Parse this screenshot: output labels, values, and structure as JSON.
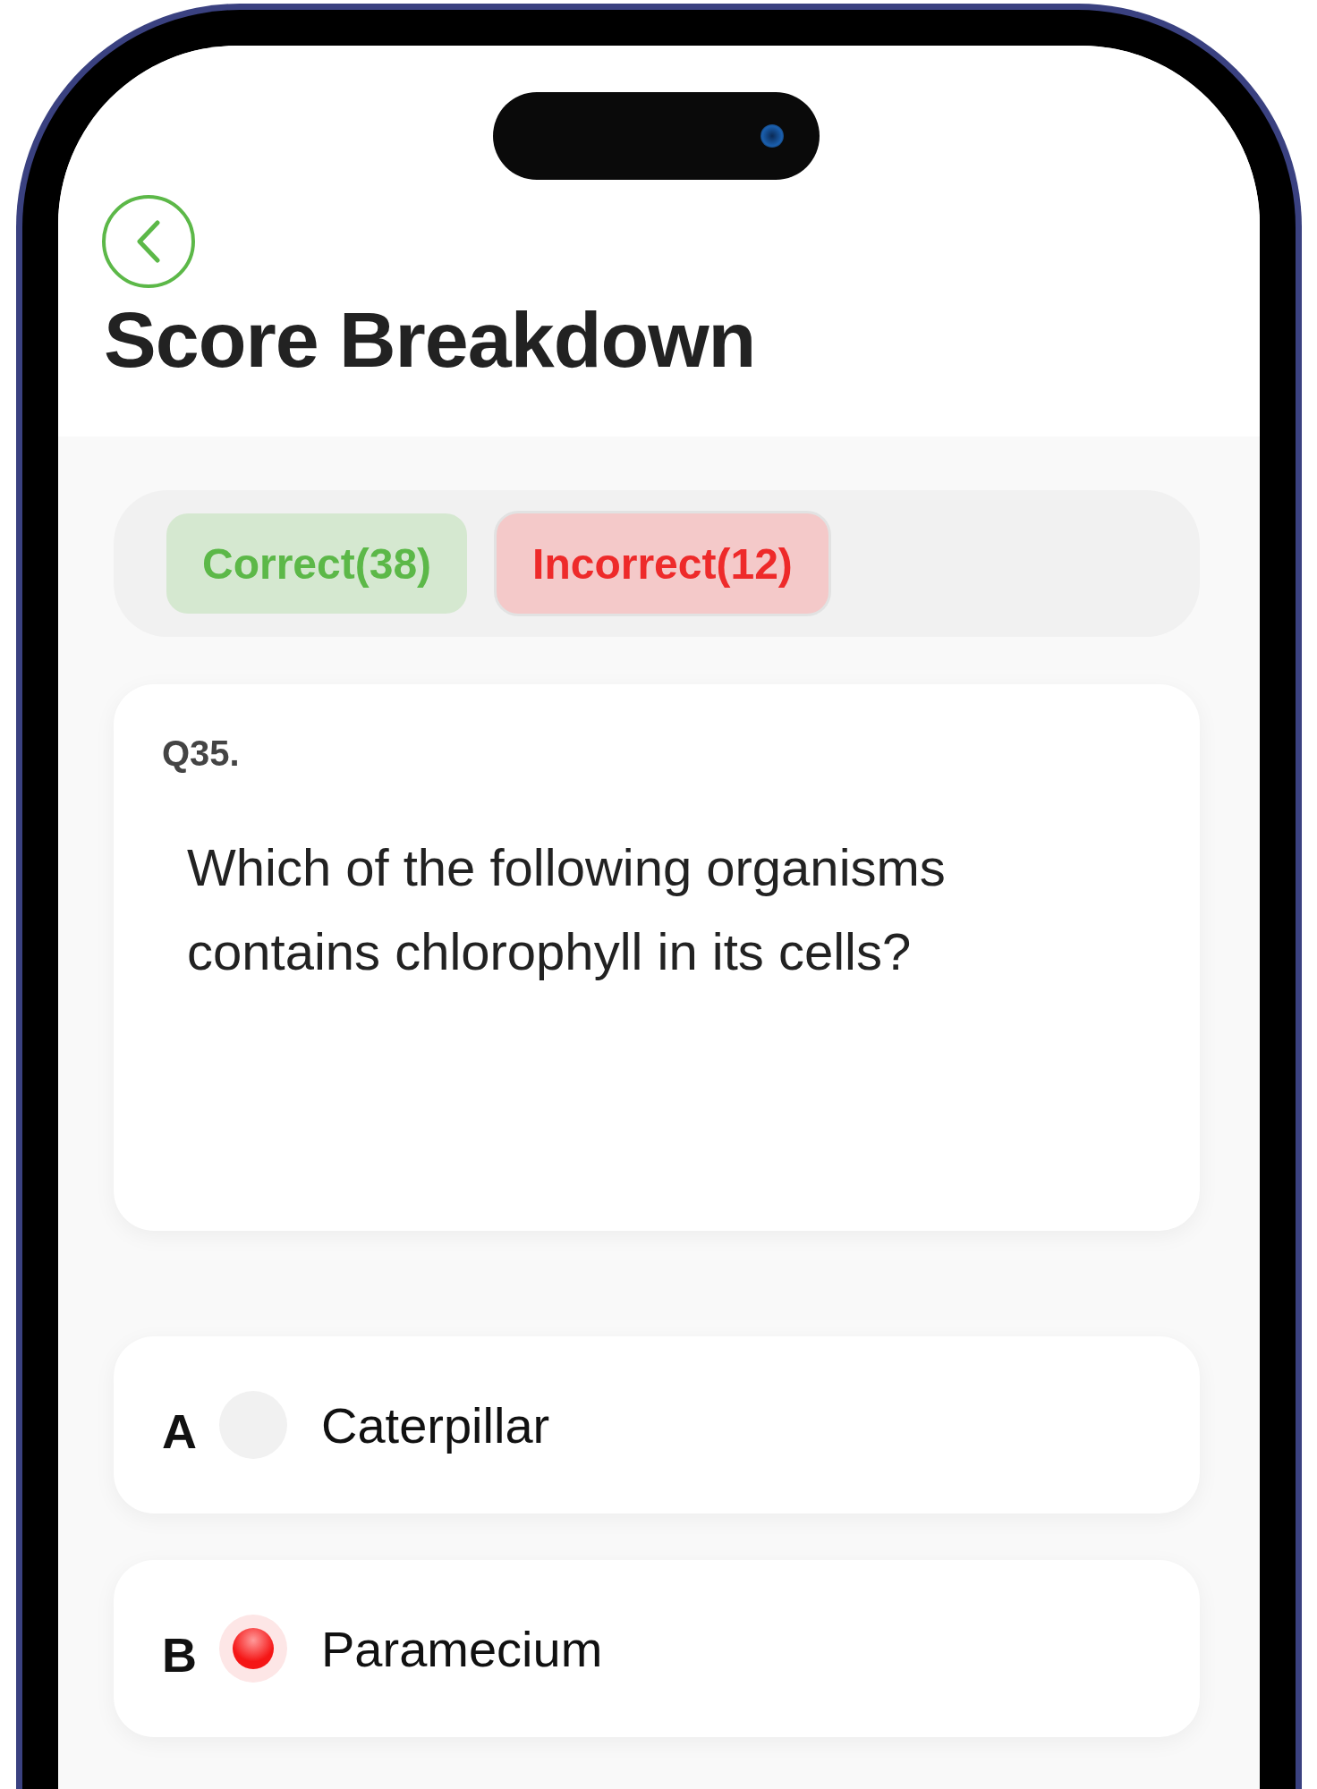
{
  "header": {
    "title": "Score Breakdown"
  },
  "tabs": [
    {
      "label": "Correct(38)",
      "kind": "correct",
      "selected": false
    },
    {
      "label": "Incorrect(12)",
      "kind": "incorrect",
      "selected": true
    }
  ],
  "question": {
    "number": "Q35.",
    "text": "Which of the following organisms contains chlorophyll in its cells?"
  },
  "options": [
    {
      "letter": "A",
      "text": "Caterpillar",
      "selected": false
    },
    {
      "letter": "B",
      "text": "Paramecium",
      "selected": true
    }
  ]
}
